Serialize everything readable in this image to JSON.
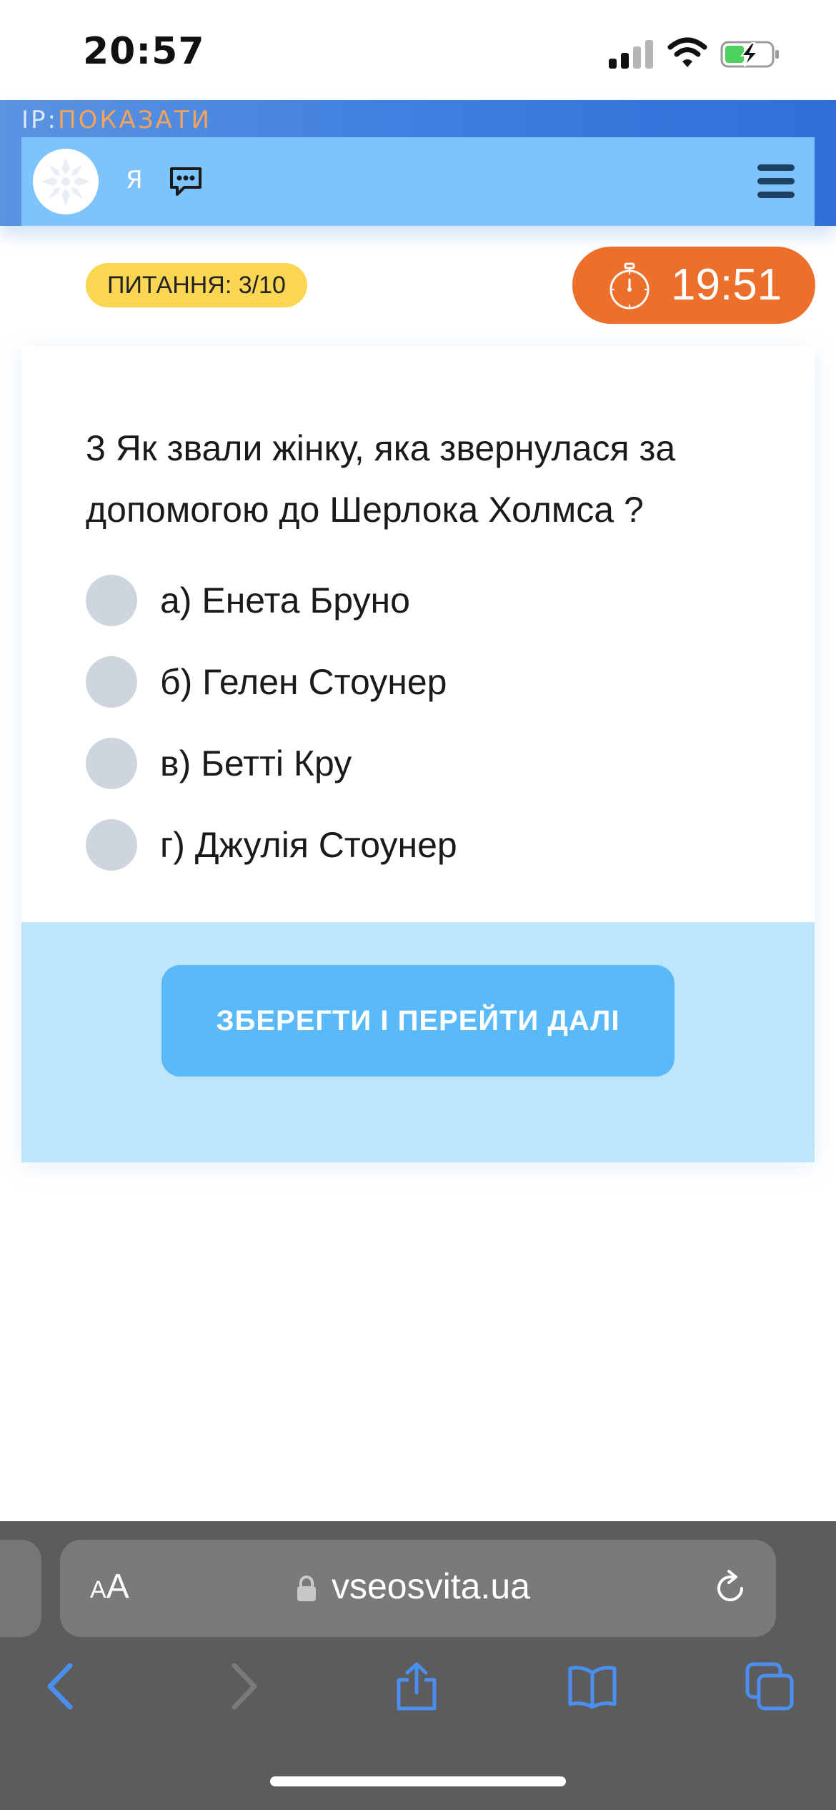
{
  "status_bar": {
    "time": "20:57"
  },
  "header": {
    "ip_label": "IP:",
    "ip_link": "ПОКАЗАТИ",
    "user_initial": "Я"
  },
  "quiz": {
    "counter": "ПИТАННЯ: 3/10",
    "timer": "19:51",
    "question": "3 Як звали жінку, яка звернулася за допомогою до Шерлока Холмса ?",
    "options": [
      {
        "label": "а) Енета Бруно",
        "selected": false
      },
      {
        "label": "б) Гелен Стоунер",
        "selected": false
      },
      {
        "label": "в) Бетті Кру",
        "selected": false
      },
      {
        "label": "г) Джулія Стоунер",
        "selected": false
      }
    ],
    "submit_label": "ЗБЕРЕГТИ І ПЕРЕЙТИ ДАЛІ"
  },
  "browser": {
    "text_size_small": "A",
    "text_size_big": "A",
    "url": "vseosvita.ua"
  },
  "colors": {
    "header_bar": "#7ec3fb",
    "counter_badge": "#fbd653",
    "timer": "#ec6f2c",
    "submit_button": "#5ab9f8",
    "card_footer": "#bee6fb",
    "ip_link": "#f5a25a"
  },
  "icons": [
    "signal-icon",
    "wifi-icon",
    "battery-charging-icon",
    "ornament-logo-icon",
    "chat-icon",
    "hamburger-menu-icon",
    "stopwatch-icon",
    "lock-icon",
    "reload-icon",
    "back-icon",
    "forward-icon",
    "share-icon",
    "bookmarks-icon",
    "tabs-icon"
  ]
}
